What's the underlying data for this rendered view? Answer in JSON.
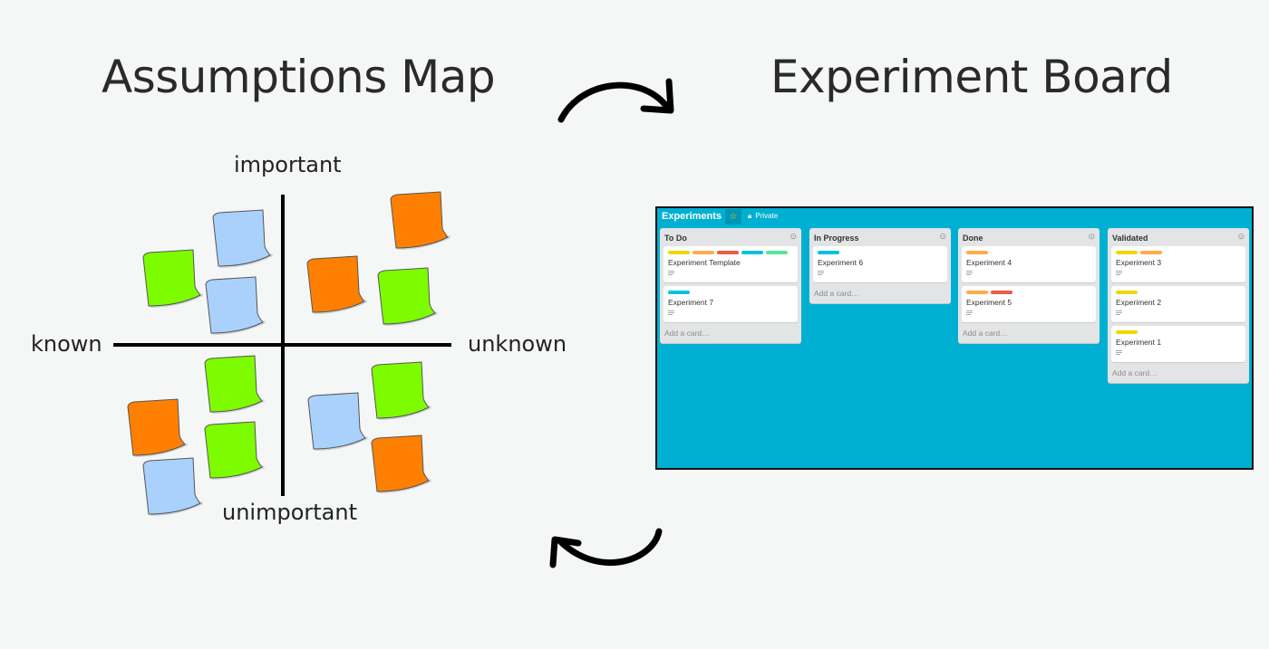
{
  "titles": {
    "left": "Assumptions Map",
    "right": "Experiment Board"
  },
  "assumptions_map": {
    "axis_labels": {
      "top": "important",
      "bottom": "unimportant",
      "left": "known",
      "right": "unknown"
    },
    "colors": {
      "blue": "#a9d1fb",
      "green": "#7dfc00",
      "orange": "#ff8000",
      "outline": "#555555"
    },
    "quadrants": {
      "important_known": [
        "green",
        "blue",
        "blue"
      ],
      "important_unknown": [
        "orange",
        "orange",
        "green"
      ],
      "unimportant_known": [
        "green",
        "orange",
        "green",
        "blue"
      ],
      "unimportant_unknown": [
        "blue",
        "green",
        "orange"
      ]
    }
  },
  "cycle_arrows": [
    {
      "name": "to-experiment-board",
      "direction": "clockwise-right"
    },
    {
      "name": "to-assumptions-map",
      "direction": "back-left"
    }
  ],
  "board": {
    "title": "Experiments",
    "star_icon": "star-icon",
    "visibility_icon": "lock-icon",
    "visibility": "Private",
    "background": "#00b0d2",
    "label_colors": {
      "yellow": "#f2d600",
      "orange": "#ffab4a",
      "red": "#eb5a46",
      "blue": "#00c2e0",
      "green": "#51e898"
    },
    "add_card_text": "Add a card…",
    "lists": [
      {
        "title": "To Do",
        "cards": [
          {
            "title": "Experiment Template",
            "labels": [
              "yellow",
              "orange",
              "red",
              "blue",
              "green"
            ]
          },
          {
            "title": "Experiment 7",
            "labels": [
              "blue"
            ]
          }
        ]
      },
      {
        "title": "In Progress",
        "cards": [
          {
            "title": "Experiment 6",
            "labels": [
              "blue"
            ]
          }
        ]
      },
      {
        "title": "Done",
        "cards": [
          {
            "title": "Experiment 4",
            "labels": [
              "orange"
            ]
          },
          {
            "title": "Experiment 5",
            "labels": [
              "orange",
              "red"
            ]
          }
        ]
      },
      {
        "title": "Validated",
        "cards": [
          {
            "title": "Experiment 3",
            "labels": [
              "yellow",
              "orange"
            ]
          },
          {
            "title": "Experiment 2",
            "labels": [
              "yellow"
            ]
          },
          {
            "title": "Experiment 1",
            "labels": [
              "yellow"
            ]
          }
        ]
      }
    ]
  }
}
